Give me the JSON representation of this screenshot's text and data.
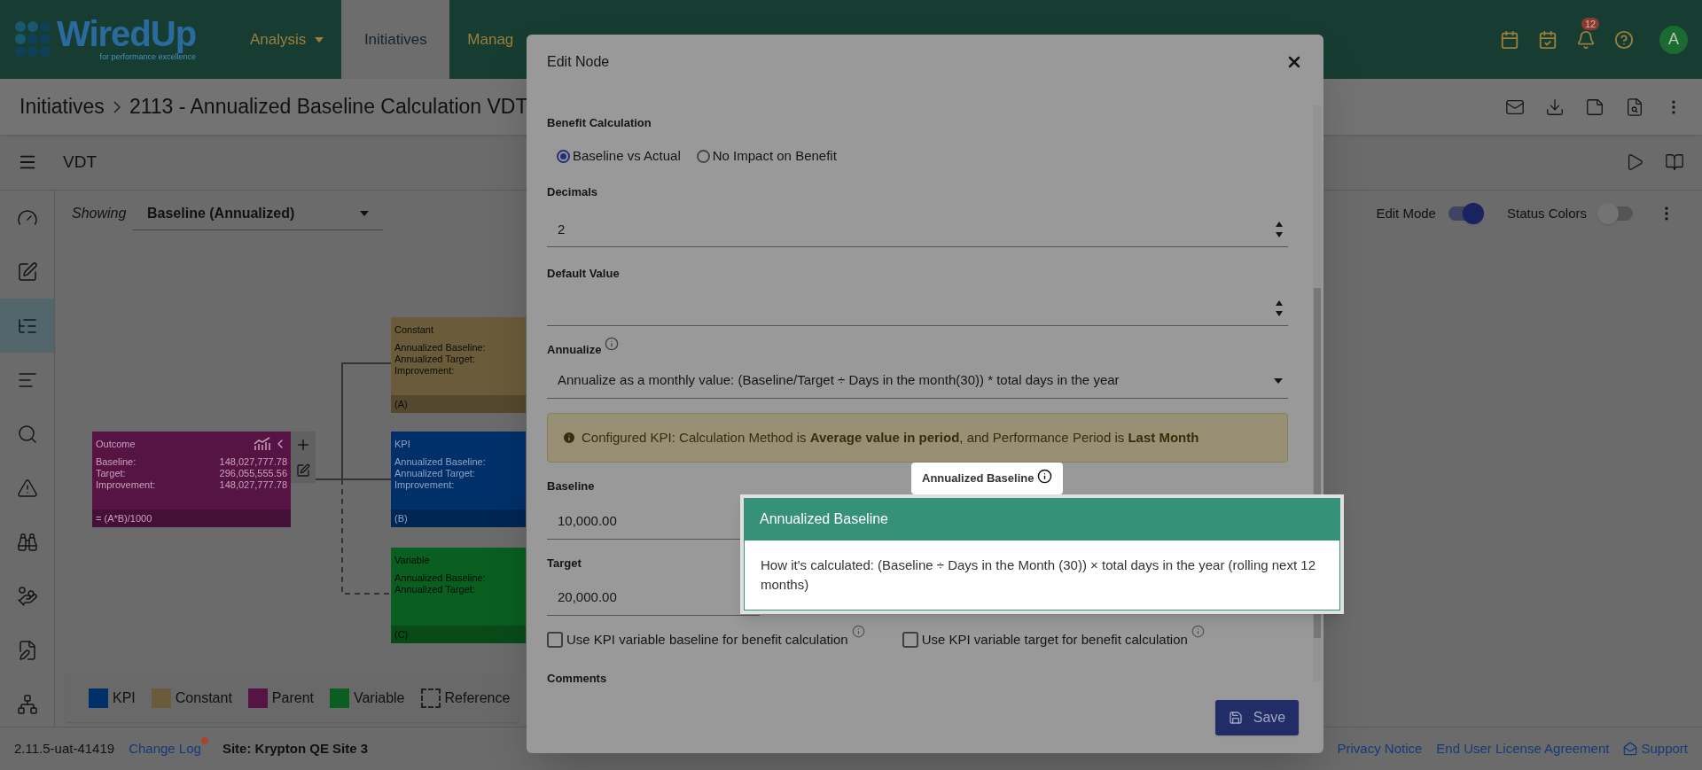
{
  "header": {
    "logo": {
      "wordmark": "WiredUp",
      "tagline": "for performance excellence"
    },
    "nav": [
      {
        "label": "Analysis",
        "has_menu": true,
        "selected": false
      },
      {
        "label": "Initiatives",
        "has_menu": false,
        "selected": true
      },
      {
        "label": "Manag",
        "has_menu": false,
        "selected": false
      }
    ],
    "notification_count": "12",
    "avatar": "A"
  },
  "breadcrumb": [
    {
      "label": "Initiatives"
    },
    {
      "label": "2113 - Annualized Baseline Calculation VDT"
    }
  ],
  "toolbar": {
    "title": "VDT"
  },
  "sidebar": {
    "items": [
      {
        "selected": false
      },
      {
        "selected": false
      },
      {
        "selected": true
      },
      {
        "selected": false
      },
      {
        "selected": false
      },
      {
        "selected": false
      },
      {
        "selected": false
      },
      {
        "selected": false
      },
      {
        "selected": false
      },
      {
        "selected": false
      }
    ]
  },
  "canvas": {
    "showing_label": "Showing",
    "view": "Baseline (Annualized)",
    "edit_mode": {
      "label": "Edit Mode",
      "on": true
    },
    "status_colors": {
      "label": "Status Colors",
      "on": false
    },
    "nodes": [
      {
        "kind": "parent",
        "title": "Outcome",
        "color": "#561444",
        "rows": [
          {
            "label": "Baseline:",
            "value": "148,027,777.78"
          },
          {
            "label": "Target:",
            "value": "296,055,555.56"
          },
          {
            "label": "Improvement:",
            "value": "148,027,777.78"
          }
        ],
        "footer": "= (A*B)/1000"
      },
      {
        "kind": "constant",
        "title": "Constant",
        "color": "#6a5c3a",
        "rows": [
          {
            "label": "Annualized Baseline:"
          },
          {
            "label": "Annualized Target:"
          },
          {
            "label": "Improvement:"
          }
        ],
        "footer": "(A)"
      },
      {
        "kind": "kpi",
        "title": "KPI",
        "color": "#00306a",
        "rows": [
          {
            "label": "Annualized Baseline:"
          },
          {
            "label": "Annualized Target:"
          },
          {
            "label": "Improvement:"
          }
        ],
        "footer": "(B)"
      },
      {
        "kind": "variable",
        "title": "Variable",
        "color": "#0a5e20",
        "rows": [
          {
            "label": "Annualized Baseline:"
          },
          {
            "label": "Annualized Target:"
          }
        ],
        "footer": "(C)"
      }
    ],
    "legend": [
      {
        "kind": "swatch",
        "label": "KPI",
        "color": "#00306a"
      },
      {
        "kind": "swatch",
        "label": "Constant",
        "color": "#6a5c3a"
      },
      {
        "kind": "swatch",
        "label": "Parent",
        "color": "#561444"
      },
      {
        "kind": "swatch",
        "label": "Variable",
        "color": "#0a5e20"
      },
      {
        "kind": "outline",
        "label": "Reference"
      }
    ]
  },
  "footer": {
    "version": "2.11.5-uat-41419",
    "change_log": {
      "label": "Change Log",
      "has_update": true
    },
    "site": "Site: Krypton QE Site 3",
    "links": [
      {
        "kind": "link",
        "label": "Privacy Notice"
      },
      {
        "kind": "link",
        "label": "End User License Agreement"
      },
      {
        "kind": "support",
        "label": "Support"
      }
    ]
  },
  "modal": {
    "title": "Edit Node",
    "benefit_calculation": {
      "label": "Benefit Calculation",
      "options": [
        {
          "label": "Baseline vs Actual",
          "selected": true
        },
        {
          "label": "No Impact on Benefit",
          "selected": false
        }
      ]
    },
    "decimals": {
      "label": "Decimals",
      "value": "2"
    },
    "default_value": {
      "label": "Default Value"
    },
    "annualize": {
      "label": "Annualize",
      "value": "Annualize as a monthly value: (Baseline/Target ÷ Days in the month(30)) * total days in the year"
    },
    "notice": "Configured KPI: Calculation Method is **Average value in period**, and Performance Period is **Last Month**",
    "baseline": {
      "label": "Baseline",
      "value": "10,000.00"
    },
    "target": {
      "label": "Target",
      "value": "20,000.00"
    },
    "options": [
      {
        "label": "Use KPI variable baseline for benefit calculation",
        "checked": false
      },
      {
        "label": "Use KPI variable target for benefit calculation",
        "checked": false
      }
    ],
    "comments": {
      "label": "Comments"
    },
    "save": "Save"
  },
  "tooltip": {
    "anchor_label": "Annualized Baseline",
    "title": "Annualized Baseline",
    "body": "How it's calculated: (Baseline ÷ Days in the Month (30)) × total days in the year (rolling next 12 months)"
  }
}
